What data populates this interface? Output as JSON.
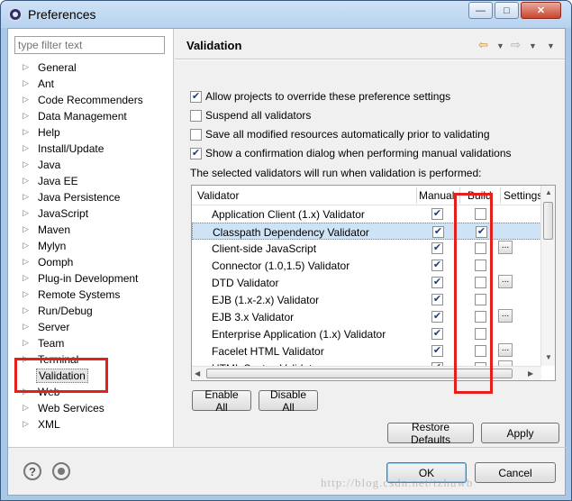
{
  "window": {
    "title": "Preferences",
    "minimize": "—",
    "maximize": "□",
    "close": "✕"
  },
  "filter": {
    "placeholder": "type filter text"
  },
  "tree": [
    {
      "label": "General",
      "arrow": true
    },
    {
      "label": "Ant",
      "arrow": true
    },
    {
      "label": "Code Recommenders",
      "arrow": true
    },
    {
      "label": "Data Management",
      "arrow": true
    },
    {
      "label": "Help",
      "arrow": true
    },
    {
      "label": "Install/Update",
      "arrow": true
    },
    {
      "label": "Java",
      "arrow": true
    },
    {
      "label": "Java EE",
      "arrow": true
    },
    {
      "label": "Java Persistence",
      "arrow": true
    },
    {
      "label": "JavaScript",
      "arrow": true
    },
    {
      "label": "Maven",
      "arrow": true
    },
    {
      "label": "Mylyn",
      "arrow": true
    },
    {
      "label": "Oomph",
      "arrow": true
    },
    {
      "label": "Plug-in Development",
      "arrow": true
    },
    {
      "label": "Remote Systems",
      "arrow": true
    },
    {
      "label": "Run/Debug",
      "arrow": true
    },
    {
      "label": "Server",
      "arrow": true
    },
    {
      "label": "Team",
      "arrow": true
    },
    {
      "label": "Terminal",
      "arrow": true
    },
    {
      "label": "Validation",
      "arrow": false,
      "selected": true
    },
    {
      "label": "Web",
      "arrow": true
    },
    {
      "label": "Web Services",
      "arrow": true
    },
    {
      "label": "XML",
      "arrow": true
    }
  ],
  "page": {
    "title": "Validation",
    "options": [
      {
        "label": "Allow projects to override these preference settings",
        "checked": true
      },
      {
        "label": "Suspend all validators",
        "checked": false
      },
      {
        "label": "Save all modified resources automatically prior to validating",
        "checked": false
      },
      {
        "label": "Show a confirmation dialog when performing manual validations",
        "checked": true
      }
    ],
    "note": "The selected validators will run when validation is performed:"
  },
  "table": {
    "columns": [
      "Validator",
      "Manual",
      "Build",
      "Settings"
    ],
    "rows": [
      {
        "name": "Application Client (1.x) Validator",
        "manual": true,
        "build": false,
        "settings": false
      },
      {
        "name": "Classpath Dependency Validator",
        "manual": true,
        "build": true,
        "settings": false,
        "selected": true
      },
      {
        "name": "Client-side JavaScript",
        "manual": true,
        "build": false,
        "settings": true
      },
      {
        "name": "Connector (1.0,1.5) Validator",
        "manual": true,
        "build": false,
        "settings": false
      },
      {
        "name": "DTD Validator",
        "manual": true,
        "build": false,
        "settings": true
      },
      {
        "name": "EJB (1.x-2.x) Validator",
        "manual": true,
        "build": false,
        "settings": false
      },
      {
        "name": "EJB 3.x Validator",
        "manual": true,
        "build": false,
        "settings": true
      },
      {
        "name": "Enterprise Application (1.x) Validator",
        "manual": true,
        "build": false,
        "settings": false
      },
      {
        "name": "Facelet HTML Validator",
        "manual": true,
        "build": false,
        "settings": true
      },
      {
        "name": "HTML Syntax Validator",
        "manual": true,
        "build": false,
        "settings": true
      }
    ],
    "settings_label": "..."
  },
  "buttons": {
    "enable_all": "Enable All",
    "disable_all": "Disable All",
    "restore_defaults": "Restore Defaults",
    "apply": "Apply",
    "ok": "OK",
    "cancel": "Cancel"
  },
  "footer": {
    "help_icon": "?"
  },
  "watermark": "http://blog.csdn.net/tzhuwb",
  "colors": {
    "accent": "#e5201a",
    "selection": "#cfe3f7"
  }
}
